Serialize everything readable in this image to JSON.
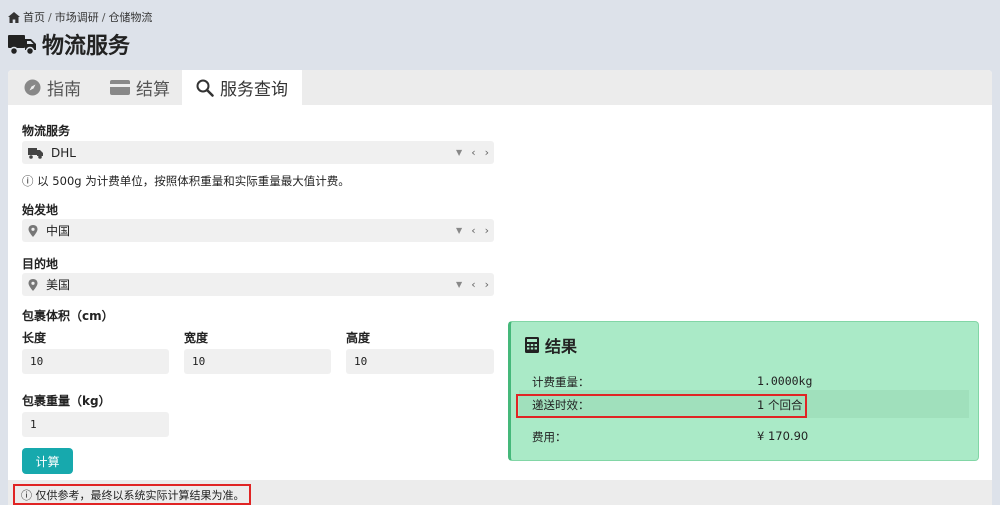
{
  "breadcrumb": {
    "home": "首页",
    "sep": "/",
    "item1": "市场调研",
    "item2": "仓储物流"
  },
  "page_title": "物流服务",
  "tabs": [
    {
      "label": "指南",
      "icon": "compass-icon"
    },
    {
      "label": "结算",
      "icon": "credit-card-icon"
    },
    {
      "label": "服务查询",
      "icon": "search-icon"
    }
  ],
  "form": {
    "service_label": "物流服务",
    "service_value": "DHL",
    "service_note": "ⓘ 以 500g 为计费单位，按照体积重量和实际重量最大值计费。",
    "origin_label": "始发地",
    "origin_value": "中国",
    "dest_label": "目的地",
    "dest_value": "美国",
    "volume_label": "包裹体积（cm）",
    "length_label": "长度",
    "length_value": "10",
    "width_label": "宽度",
    "width_value": "10",
    "height_label": "高度",
    "height_value": "10",
    "weight_label": "包裹重量（kg）",
    "weight_value": "1",
    "calc_button": "计算"
  },
  "result": {
    "title": "结果",
    "rows": [
      {
        "key": "计费重量：",
        "value": "1.0000kg"
      },
      {
        "key": "递送时效：",
        "value": "1 个回合"
      },
      {
        "key": "费用：",
        "value": "¥ 170.90"
      }
    ]
  },
  "footer_note": "ⓘ 仅供参考，最终以系统实际计算结果为准。",
  "colors": {
    "accent": "#17a9ad",
    "result_bg": "#aaeac7",
    "highlight": "#e02424"
  }
}
